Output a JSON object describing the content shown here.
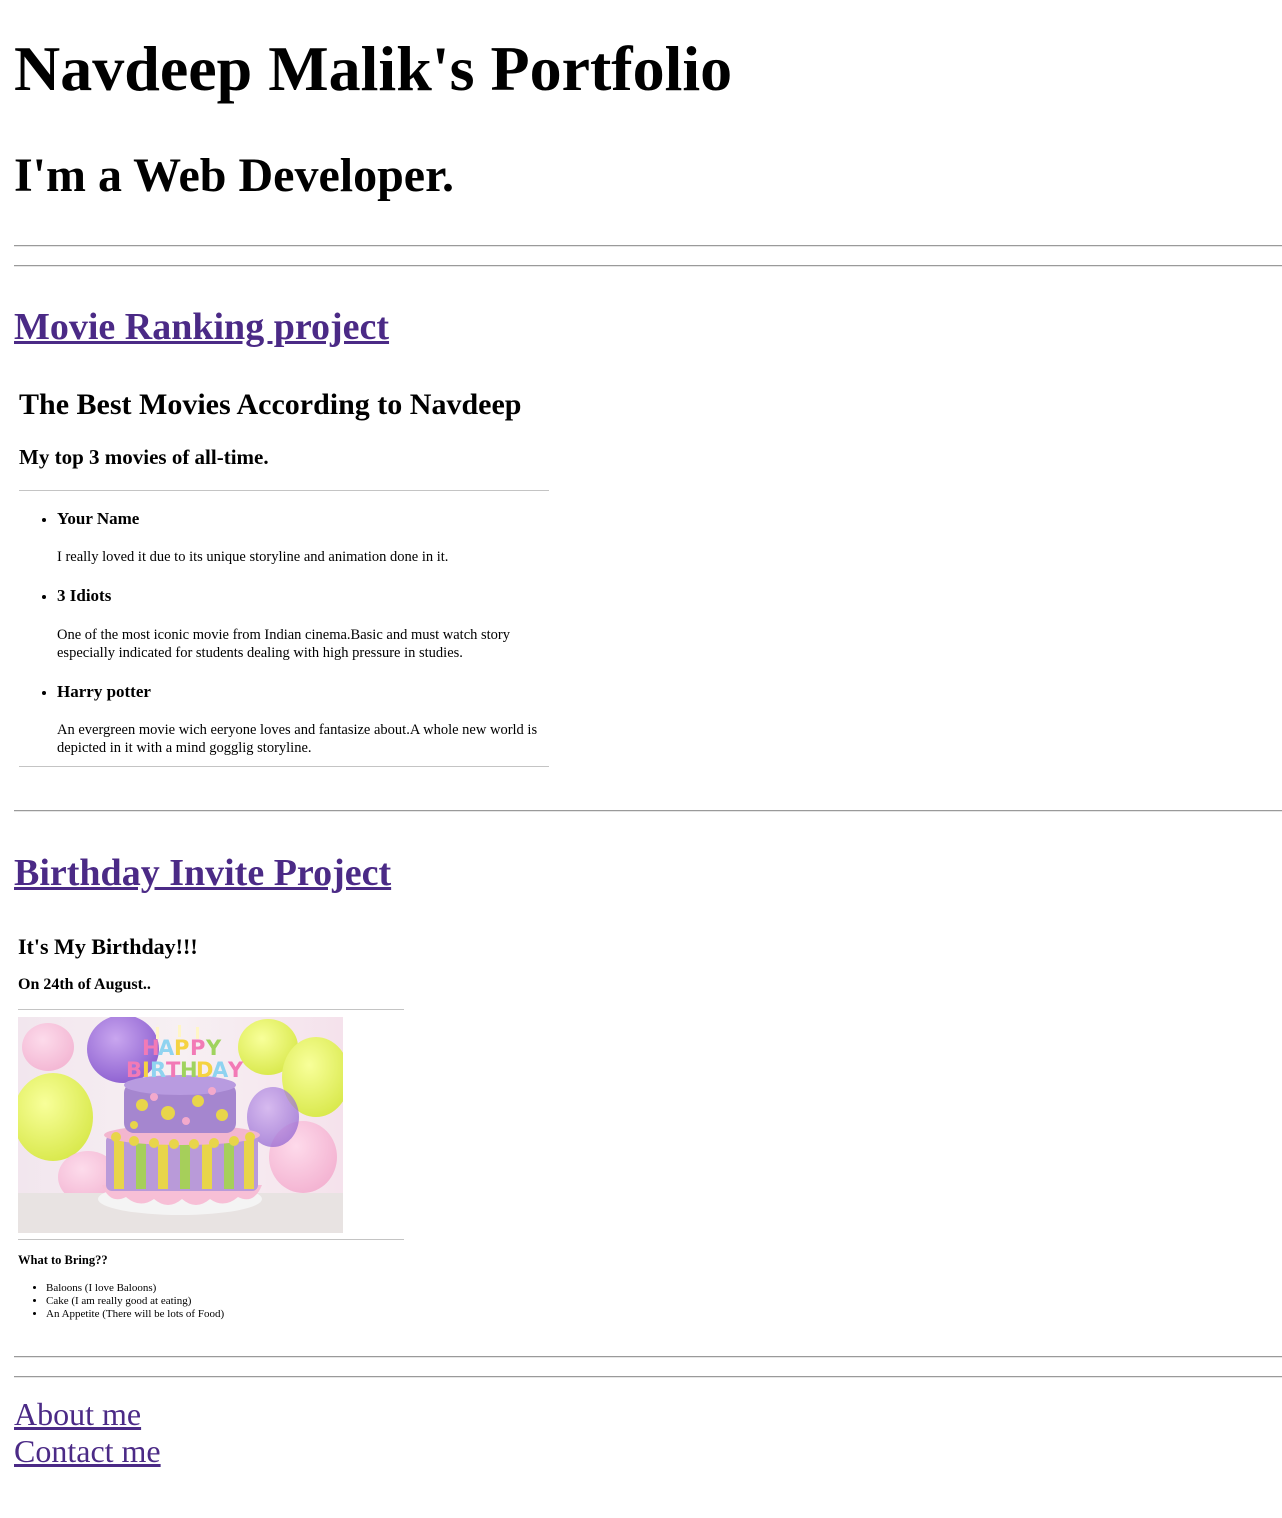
{
  "page_title": "Navdeep Malik's Portfolio",
  "subtitle": "I'm a Web Developer.",
  "projects": [
    {
      "link_label": "Movie Ranking project"
    },
    {
      "link_label": "Birthday Invite Project"
    }
  ],
  "movies": {
    "heading": "The Best Movies According to Navdeep",
    "subheading": "My top 3 movies of all-time.",
    "items": [
      {
        "name": "Your Name",
        "description": "I really loved it due to its unique storyline and animation done in it."
      },
      {
        "name": "3 Idiots",
        "description": "One of the most iconic movie from Indian cinema.Basic and must watch story especially indicated for students dealing with high pressure in studies."
      },
      {
        "name": "Harry potter",
        "description": "An evergreen movie wich eeryone loves and fantasize about.A whole new world is depicted in it with a mind gogglig storyline."
      }
    ]
  },
  "birthday": {
    "heading": "It's My Birthday!!!",
    "date": "On 24th of August..",
    "image_candles_text": "HAPPY BIRTHDAY",
    "bring_heading": "What to Bring??",
    "bring_items": [
      "Baloons (I love Baloons)",
      "Cake (I am really good at eating)",
      "An Appetite (There will be lots of Food)"
    ]
  },
  "footer_links": {
    "about": "About me",
    "contact": "Contact me"
  },
  "colors": {
    "link": "#4b2a86",
    "rule": "#9a9a9a"
  }
}
